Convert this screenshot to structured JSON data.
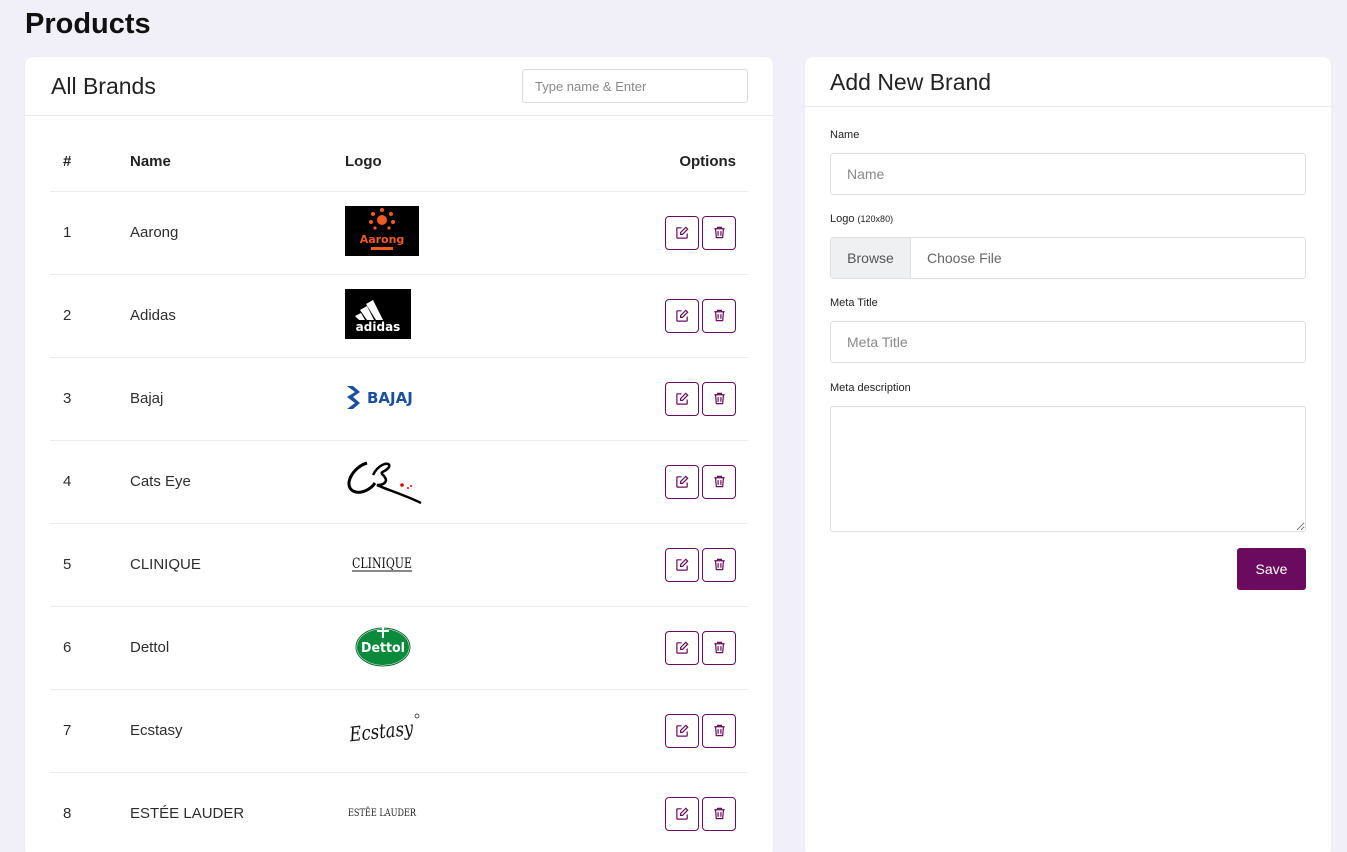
{
  "page": {
    "title": "Products"
  },
  "brands_panel": {
    "title": "All Brands",
    "search_placeholder": "Type name & Enter",
    "columns": {
      "num": "#",
      "name": "Name",
      "logo": "Logo",
      "options": "Options"
    },
    "rows": [
      {
        "num": "1",
        "name": "Aarong",
        "logo_text": "Aarong"
      },
      {
        "num": "2",
        "name": "Adidas",
        "logo_text": "adidas"
      },
      {
        "num": "3",
        "name": "Bajaj",
        "logo_text": "BAJAJ"
      },
      {
        "num": "4",
        "name": "Cats Eye",
        "logo_text": ""
      },
      {
        "num": "5",
        "name": "CLINIQUE",
        "logo_text": "CLINIQUE"
      },
      {
        "num": "6",
        "name": "Dettol",
        "logo_text": "Dettol"
      },
      {
        "num": "7",
        "name": "Ecstasy",
        "logo_text": "Ecstasy"
      },
      {
        "num": "8",
        "name": "ESTÉE LAUDER",
        "logo_text": "ESTĒE LAUDER"
      }
    ]
  },
  "add_panel": {
    "title": "Add New Brand",
    "name_label": "Name",
    "name_placeholder": "Name",
    "logo_label": "Logo",
    "logo_hint": "(120x80)",
    "browse_label": "Browse",
    "choose_file_label": "Choose File",
    "meta_title_label": "Meta Title",
    "meta_title_placeholder": "Meta Title",
    "meta_desc_label": "Meta description",
    "save_label": "Save"
  },
  "colors": {
    "accent": "#6b0b5f",
    "background": "#f1eff8"
  }
}
